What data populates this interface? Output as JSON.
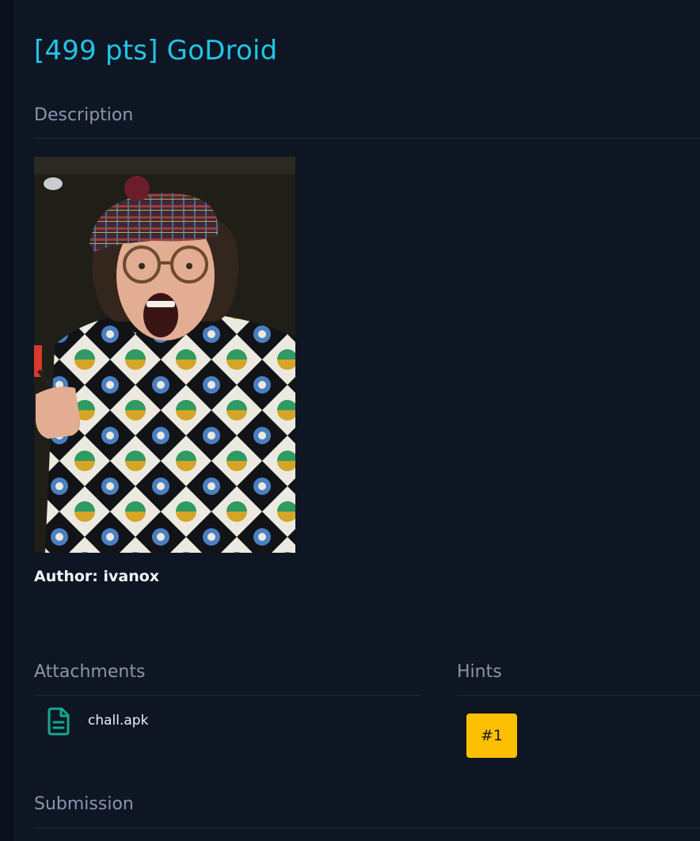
{
  "challenge": {
    "title": "[499 pts] GoDroid",
    "author": "Author: ivanox"
  },
  "sections": {
    "description": "Description",
    "attachments": "Attachments",
    "hints": "Hints",
    "submission": "Submission"
  },
  "attachments": [
    {
      "name": "chall.apk",
      "icon": "file-text-icon"
    }
  ],
  "hints": [
    {
      "label": "#1"
    }
  ],
  "colors": {
    "title": "#22c4e6",
    "heading": "#8a94aa",
    "background": "#0e1624",
    "hint_button": "#fdc000",
    "file_icon": "#16a78e"
  }
}
